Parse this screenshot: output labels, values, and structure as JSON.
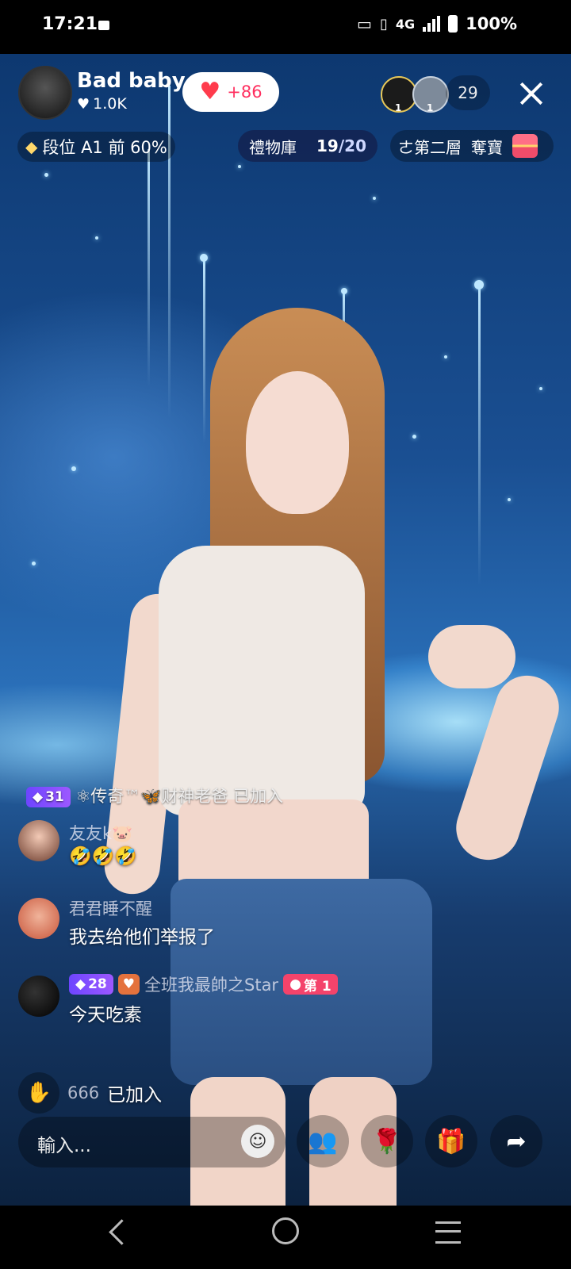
{
  "status_bar": {
    "time": "17:21",
    "network": "4G",
    "battery": "100%"
  },
  "host": {
    "name": "Bad baby",
    "likes": "1.0K",
    "follow_badge": "+86"
  },
  "viewers": {
    "top1_rank": "1",
    "top2_rank": "1",
    "count": "29"
  },
  "rank_info": {
    "text": "段位 A1 前 60%"
  },
  "gift_library": {
    "label": "禮物庫",
    "current": "19",
    "total": "/20"
  },
  "treasure": {
    "floor_text": "ㄜ第二層",
    "label": "奪寶"
  },
  "chat": {
    "join_banner": {
      "level": "31",
      "name": "⚛传奇™🦋财神老爸",
      "action": "已加入"
    },
    "messages": [
      {
        "user": "友友k🐷",
        "text": "🤣🤣🤣"
      },
      {
        "user": "君君睡不醒",
        "text": "我去给他们举报了"
      },
      {
        "level": "28",
        "user": "全班我最帥之Star",
        "rank_badge": "第 1",
        "text": "今天吃素"
      }
    ],
    "join_notice": {
      "name": "666",
      "action": "已加入"
    }
  },
  "bottom_bar": {
    "input_placeholder": "輸入...",
    "icons": [
      "emoji-icon",
      "multi-guest-icon",
      "rose-icon",
      "gift-icon",
      "share-icon"
    ]
  },
  "colors": {
    "accent_pink": "#ff2f5f",
    "diamond_badge": "#7b4dff"
  }
}
